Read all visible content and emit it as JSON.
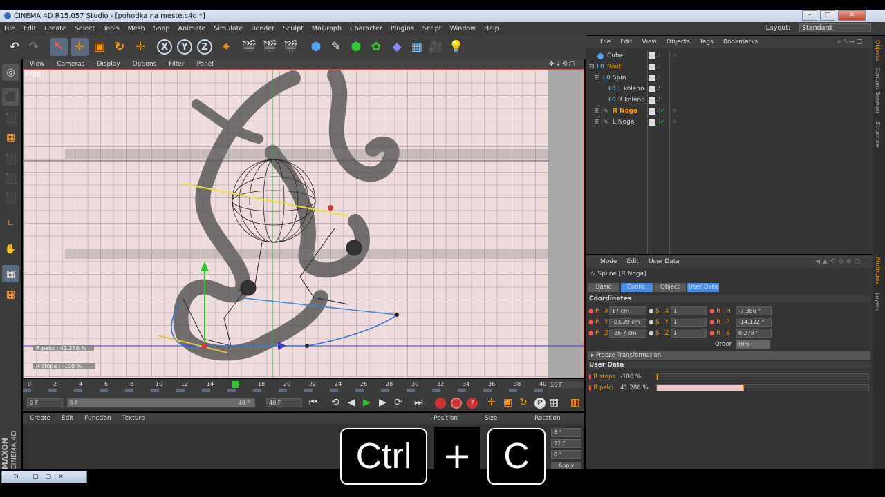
{
  "window": {
    "title": "CINEMA 4D R15.057 Studio - [pohodka na meste.c4d *]"
  },
  "menu": [
    "File",
    "Edit",
    "Create",
    "Select",
    "Tools",
    "Mesh",
    "Snap",
    "Animate",
    "Simulate",
    "Render",
    "Sculpt",
    "MoGraph",
    "Character",
    "Plugins",
    "Script",
    "Window",
    "Help"
  ],
  "layout": {
    "label": "Layout:",
    "value": "Standard"
  },
  "viewport": {
    "menu": [
      "View",
      "Cameras",
      "Display",
      "Options",
      "Filter",
      "Panel"
    ],
    "name": "Right",
    "hud_r_palci": "R palci : 41.286 %",
    "hud_r_stopa": "R stopa : -100 %"
  },
  "timeline": {
    "ticks": [
      "0",
      "2",
      "4",
      "6",
      "8",
      "10",
      "12",
      "14",
      "16",
      "18",
      "20",
      "22",
      "24",
      "26",
      "28",
      "30",
      "32",
      "34",
      "36",
      "38",
      "40"
    ],
    "current": "16 F",
    "start": "0 F",
    "range_start": "0 F",
    "range_end": "40 F",
    "end": "40 F"
  },
  "material": {
    "menu": [
      "Create",
      "Edit",
      "Function",
      "Texture"
    ]
  },
  "coords": {
    "headers": [
      "Position",
      "Size",
      "Rotation"
    ],
    "r1": "6 °",
    "r2": "22 °",
    "r3": "0 °",
    "apply": "Apply"
  },
  "objects": {
    "menu": [
      "File",
      "Edit",
      "View",
      "Objects",
      "Tags",
      "Bookmarks"
    ],
    "rows": [
      {
        "name": "Cube"
      },
      {
        "name": "Root"
      },
      {
        "name": "Spin"
      },
      {
        "name": "L koleno"
      },
      {
        "name": "R koleno"
      },
      {
        "name": "R Noga"
      },
      {
        "name": "L Noga"
      }
    ]
  },
  "attributes": {
    "menu": [
      "Mode",
      "Edit",
      "User Data"
    ],
    "object": "Spline [R Noga]",
    "tabs": [
      "Basic",
      "Coord.",
      "Object",
      "User Data"
    ],
    "section": "Coordinates",
    "px": {
      "label": "P . X",
      "value": "17 cm"
    },
    "py": {
      "label": "P . Y",
      "value": "-0.029 cm"
    },
    "pz": {
      "label": "P . Z",
      "value": "-36.7 cm"
    },
    "sx": {
      "label": "S . X",
      "value": "1"
    },
    "sy": {
      "label": "S . Y",
      "value": "1"
    },
    "sz": {
      "label": "S . Z",
      "value": "1"
    },
    "rh": {
      "label": "R . H",
      "value": "-7.386 °"
    },
    "rp": {
      "label": "R . P",
      "value": "-14.122 °"
    },
    "rb": {
      "label": "R . B",
      "value": "0.278 °"
    },
    "order_label": "Order",
    "order_value": "HPB",
    "freeze": "Freeze Transformation",
    "userdata": "User Data",
    "r_stopa": {
      "label": "R stopa",
      "value": "-100 %",
      "fraction": 0.0
    },
    "r_palci": {
      "label": "R palci",
      "value": "41.286 %",
      "fraction": 0.41286
    }
  },
  "sidetabs": [
    "Objects",
    "Content Browser",
    "Structure",
    "Attributes",
    "Layers"
  ],
  "keys": {
    "k1": "Ctrl",
    "k2": "+",
    "k3": "C"
  },
  "branding": {
    "maxon": "MAXON",
    "c4d": "CINEMA 4D"
  },
  "taskbar_item": "Ti..."
}
